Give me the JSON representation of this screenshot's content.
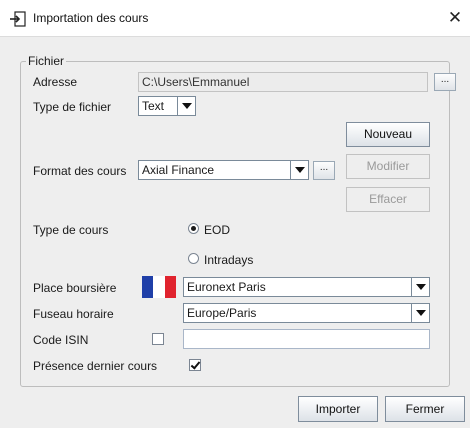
{
  "window": {
    "title": "Importation des cours",
    "icon": "import-icon"
  },
  "group": {
    "legend": "Fichier"
  },
  "adresse": {
    "label": "Adresse",
    "value": "C:\\Users\\Emmanuel",
    "browse": "..."
  },
  "type_fichier": {
    "label": "Type de fichier",
    "value": "Text"
  },
  "format": {
    "label": "Format des cours",
    "value": "Axial Finance",
    "browse": "...",
    "nouveau": "Nouveau",
    "modifier": "Modifier",
    "effacer": "Effacer"
  },
  "type_cours": {
    "label": "Type de cours",
    "options": [
      "EOD",
      "Intradays"
    ],
    "selected": "EOD"
  },
  "place": {
    "label": "Place boursière",
    "value": "Euronext Paris",
    "flag_colors": [
      "#1f3fa8",
      "#ffffff",
      "#e0232e"
    ]
  },
  "fuseau": {
    "label": "Fuseau horaire",
    "value": "Europe/Paris"
  },
  "isin": {
    "label": "Code ISIN",
    "checked": false,
    "value": ""
  },
  "presence": {
    "label": "Présence dernier cours",
    "checked": true
  },
  "footer": {
    "importer": "Importer",
    "fermer": "Fermer"
  }
}
